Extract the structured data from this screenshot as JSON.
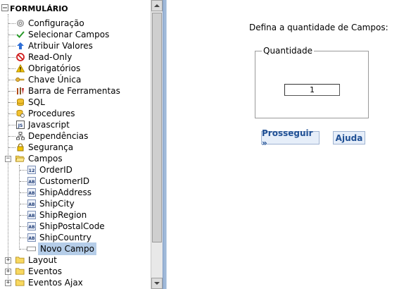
{
  "tree": {
    "root_label": "FORMULÁRIO",
    "items": [
      {
        "label": "Configuração",
        "icon": "gear-icon"
      },
      {
        "label": "Selecionar Campos",
        "icon": "check-icon"
      },
      {
        "label": "Atribuir Valores",
        "icon": "arrow-up-icon"
      },
      {
        "label": "Read-Only",
        "icon": "prohibited-icon"
      },
      {
        "label": "Obrigatórios",
        "icon": "warning-icon"
      },
      {
        "label": "Chave Única",
        "icon": "key-icon"
      },
      {
        "label": "Barra de Ferramentas",
        "icon": "toolbar-icon"
      },
      {
        "label": "SQL",
        "icon": "database-icon"
      },
      {
        "label": "Procedures",
        "icon": "procedure-icon"
      },
      {
        "label": "Javascript",
        "icon": "javascript-icon"
      },
      {
        "label": "Dependências",
        "icon": "dependency-icon"
      },
      {
        "label": "Segurança",
        "icon": "lock-icon"
      },
      {
        "label": "Campos",
        "icon": "folder-open-icon"
      },
      {
        "label": "OrderID",
        "icon": "number-field-icon",
        "badge": "12"
      },
      {
        "label": "CustomerID",
        "icon": "text-field-icon",
        "badge": "AB"
      },
      {
        "label": "ShipAddress",
        "icon": "text-field-icon",
        "badge": "AB"
      },
      {
        "label": "ShipCity",
        "icon": "text-field-icon",
        "badge": "AB"
      },
      {
        "label": "ShipRegion",
        "icon": "text-field-icon",
        "badge": "AB"
      },
      {
        "label": "ShipPostalCode",
        "icon": "text-field-icon",
        "badge": "AB"
      },
      {
        "label": "ShipCountry",
        "icon": "text-field-icon",
        "badge": "AB"
      },
      {
        "label": "Novo Campo",
        "icon": "new-field-icon"
      },
      {
        "label": "Layout",
        "icon": "folder-icon"
      },
      {
        "label": "Eventos",
        "icon": "folder-icon"
      },
      {
        "label": "Eventos Ajax",
        "icon": "folder-icon"
      }
    ]
  },
  "form": {
    "prompt": "Defina a quantidade de Campos:",
    "legend": "Quantidade",
    "quantity_value": "1",
    "proceed_label": "Prosseguir »",
    "help_label": "Ajuda"
  },
  "colors": {
    "accent": "#1f4f94",
    "selection": "#b5cde8",
    "divider": "#9fb8d8"
  }
}
